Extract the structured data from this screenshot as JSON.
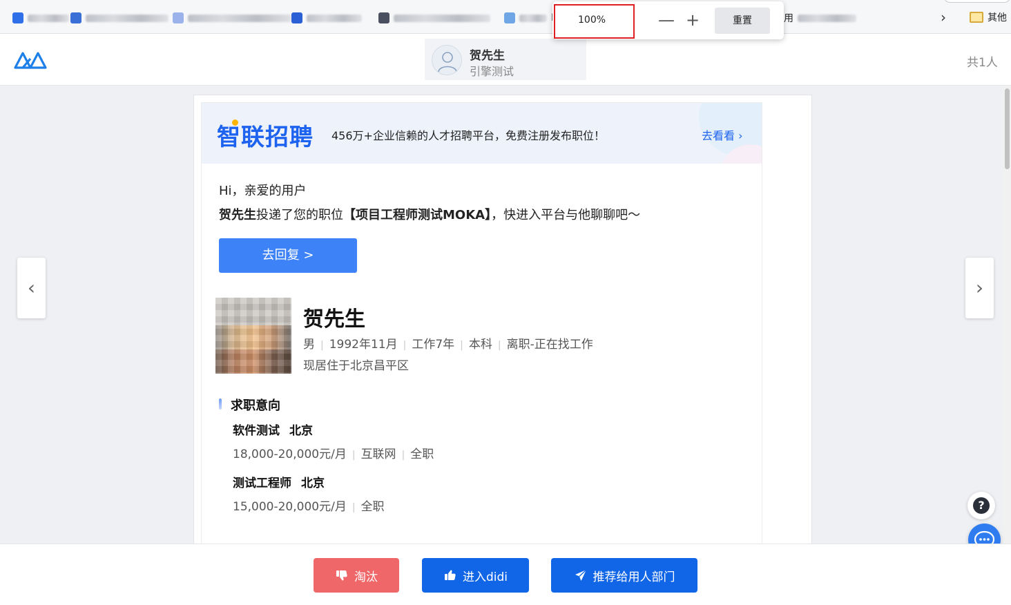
{
  "browser": {
    "zoom": {
      "value": "100%",
      "minus_label": "—",
      "plus_label": "+",
      "reset_label": "重置"
    },
    "bookmarks": {
      "more_folder_label": "其他",
      "partial_label_1": "M",
      "partial_label_2": "用"
    }
  },
  "header": {
    "candidate": {
      "name": "贺先生",
      "subtitle": "引擎测试"
    },
    "total_count": "共1人"
  },
  "email": {
    "banner": {
      "brand": "智联招聘",
      "tagline": "456万+企业信赖的人才招聘平台，免费注册发布职位！",
      "link": "去看看"
    },
    "greeting": "Hi，亲爱的用户",
    "message": {
      "name": "贺先生",
      "text1": "投递了您的职位",
      "position": "【项目工程师测试MOKA】",
      "text2": "，快进入平台与他聊聊吧～"
    },
    "reply_button": "去回复 >",
    "candidate": {
      "name": "贺先生",
      "meta": [
        "男",
        "1992年11月",
        "工作7年",
        "本科",
        "离职-正在找工作"
      ],
      "address": "现居住于北京昌平区"
    },
    "intent": {
      "title": "求职意向",
      "jobs": [
        {
          "title": "软件测试",
          "city": "北京",
          "meta": [
            "18,000-20,000元/月",
            "互联网",
            "全职"
          ]
        },
        {
          "title": "测试工程师",
          "city": "北京",
          "meta": [
            "15,000-20,000元/月",
            "全职"
          ]
        }
      ]
    }
  },
  "actions": {
    "reject": "淘汰",
    "enter": "进入didi",
    "recommend": "推荐给用人部门"
  },
  "colors": {
    "primary": "#1166e8",
    "reject": "#f0676a",
    "reply": "#3d82f6",
    "zoom_highlight": "#e02020"
  }
}
